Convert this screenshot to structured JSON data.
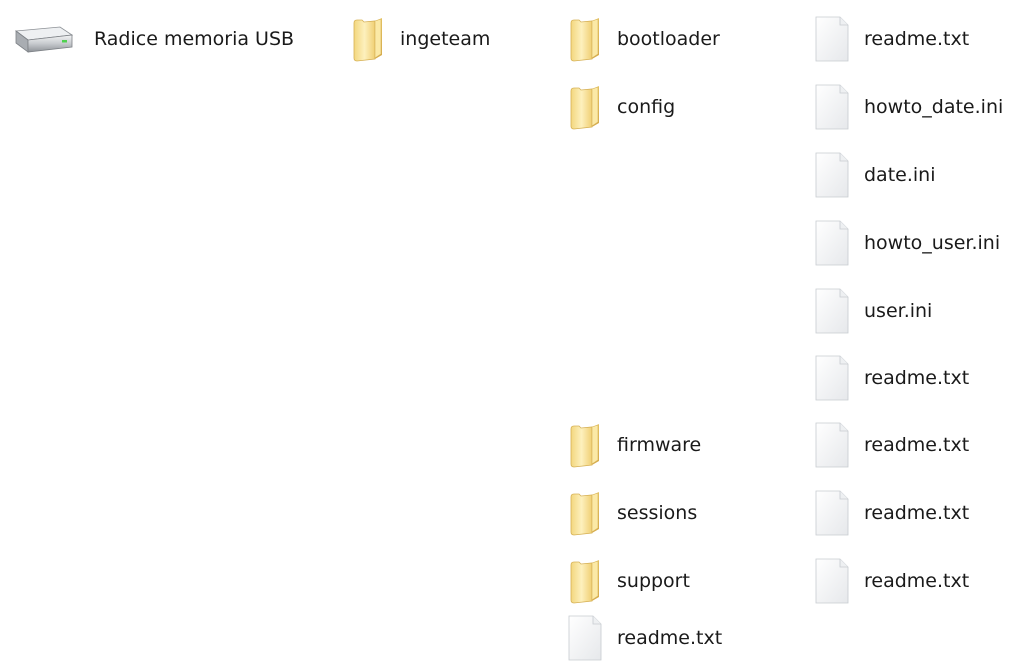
{
  "tree": {
    "root": {
      "label": "Radice memoria USB",
      "icon": "usb-drive-icon"
    },
    "level1": {
      "label": "ingeteam",
      "icon": "folder-icon"
    },
    "bootloader": {
      "label": "bootloader",
      "icon": "folder-icon",
      "children": [
        {
          "label": "readme.txt",
          "icon": "text-file-icon"
        }
      ]
    },
    "config": {
      "label": "config",
      "icon": "folder-icon",
      "children": [
        {
          "label": "howto_date.ini",
          "icon": "text-file-icon"
        },
        {
          "label": "date.ini",
          "icon": "text-file-icon"
        },
        {
          "label": "howto_user.ini",
          "icon": "text-file-icon"
        },
        {
          "label": "user.ini",
          "icon": "text-file-icon"
        },
        {
          "label": "readme.txt",
          "icon": "text-file-icon"
        }
      ]
    },
    "firmware": {
      "label": "firmware",
      "icon": "folder-icon",
      "children": [
        {
          "label": "readme.txt",
          "icon": "text-file-icon"
        }
      ]
    },
    "sessions": {
      "label": "sessions",
      "icon": "folder-icon",
      "children": [
        {
          "label": "readme.txt",
          "icon": "text-file-icon"
        }
      ]
    },
    "support": {
      "label": "support",
      "icon": "folder-icon",
      "children": [
        {
          "label": "readme.txt",
          "icon": "text-file-icon"
        }
      ]
    },
    "root_file": {
      "label": "readme.txt",
      "icon": "text-file-icon"
    }
  },
  "colors": {
    "folder_light": "#fbeaa8",
    "folder_dark": "#e3c163",
    "file_page": "#f3f4f6",
    "drive_body": "#c9ccd0"
  }
}
